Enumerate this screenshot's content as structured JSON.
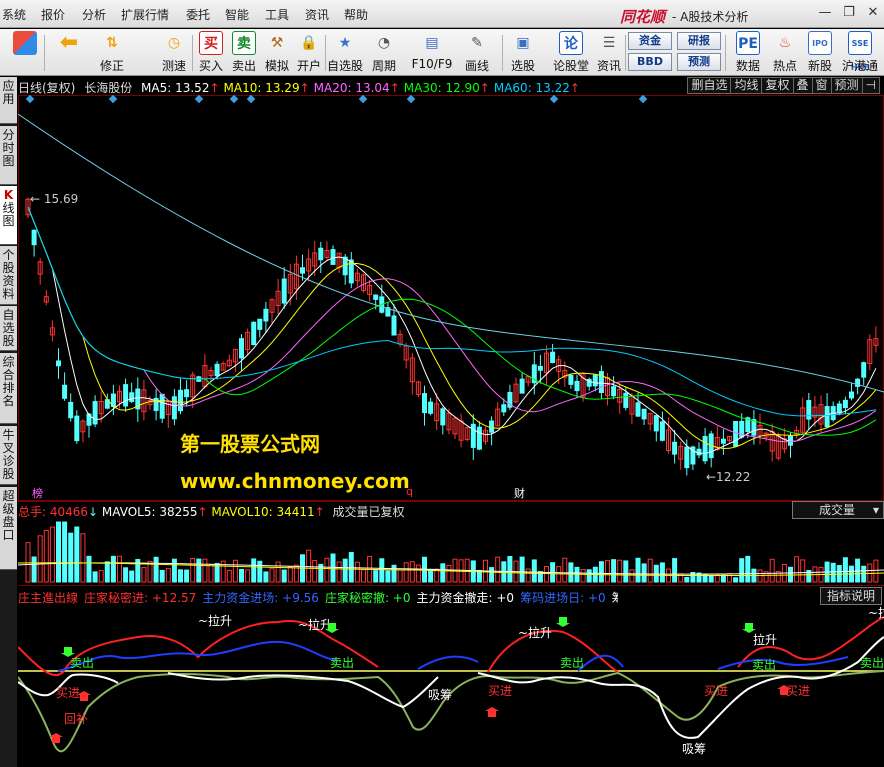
{
  "menu": [
    "系统",
    "报价",
    "分析",
    "扩展行情",
    "委托",
    "智能",
    "工具",
    "资讯",
    "帮助"
  ],
  "brand": "同花顺",
  "app_title": "- A股技术分析",
  "toolbar": {
    "items": [
      {
        "label": "",
        "icon": "grid-icon",
        "color": "#e84c3d"
      },
      {
        "label": "",
        "icon": "back-arrow-icon",
        "color": "#f0a20a"
      },
      {
        "label": "修正",
        "icon": "up-down-arrows-icon",
        "color": "#f0a20a"
      },
      {
        "label": "测速",
        "icon": "clock-icon",
        "color": "#f0a20a"
      },
      {
        "label": "买入",
        "icon": "buy-icon",
        "glyph": "买",
        "color": "#d21f1f"
      },
      {
        "label": "卖出",
        "icon": "sell-icon",
        "glyph": "卖",
        "color": "#158a2e"
      },
      {
        "label": "模拟",
        "icon": "gavel-icon",
        "color": "#b5651d"
      },
      {
        "label": "开户",
        "icon": "lock-icon",
        "color": "#c8a000"
      },
      {
        "label": "自选股",
        "icon": "star-folder-icon",
        "color": "#3a6fc4"
      },
      {
        "label": "周期",
        "icon": "clock-cycle-icon",
        "color": "#555"
      },
      {
        "label": "F10/F9",
        "icon": "f10-icon",
        "color": "#3a6fc4"
      },
      {
        "label": "画线",
        "icon": "pencil-icon",
        "color": "#555"
      },
      {
        "label": "选股",
        "icon": "chart-select-icon",
        "color": "#3a6fc4"
      },
      {
        "label": "论股堂",
        "icon": "lun-icon",
        "glyph": "论",
        "color": "#1f5fbf"
      },
      {
        "label": "资讯",
        "icon": "news-icon",
        "color": "#555"
      },
      {
        "label": "数据",
        "icon": "pe-icon",
        "glyph": "PE",
        "color": "#1f5fbf"
      },
      {
        "label": "热点",
        "icon": "hot-icon",
        "color": "#d2402d"
      },
      {
        "label": "新股",
        "icon": "ipo-icon",
        "glyph": "IPO",
        "color": "#3a6fc4"
      },
      {
        "label": "沪港通",
        "icon": "hk-connect-icon",
        "glyph": "SSE HKE",
        "color": "#1f5fbf"
      }
    ],
    "small_buttons": [
      "资金",
      "研报",
      "BBD",
      "预测"
    ]
  },
  "sidebar": [
    {
      "label": "应用"
    },
    {
      "label": "分时图"
    },
    {
      "label": "K线图",
      "active": true
    },
    {
      "label": "个股资料"
    },
    {
      "label": "自选股"
    },
    {
      "label": "综合排名"
    },
    {
      "label": "牛叉诊股"
    },
    {
      "label": "超级盘口"
    }
  ],
  "header": {
    "chart_title": "日线(复权)",
    "stock": "长海股份",
    "ma": [
      {
        "label": "MA5: 13.52",
        "color": "#ffffff"
      },
      {
        "label": "MA10: 13.29",
        "color": "#ffff00"
      },
      {
        "label": "MA20: 13.04",
        "color": "#ff66ff"
      },
      {
        "label": "MA30: 12.90",
        "color": "#00ff00"
      },
      {
        "label": "MA60: 13.22",
        "color": "#00ccff"
      }
    ],
    "ma_arrow": "↑",
    "right_buttons": [
      "删自选",
      "均线",
      "复权",
      "叠",
      "窗",
      "预测",
      "⊣"
    ]
  },
  "price_labels": {
    "high": "15.69",
    "low": "12.22"
  },
  "event_markers": [
    "榜",
    "q",
    "财"
  ],
  "watermark": {
    "line1": "第一股票公式网",
    "line2": "www.chnmoney.com"
  },
  "volume": {
    "total_label": "总手: 40466",
    "mavol5": "MAVOL5: 38255",
    "mavol10": "MAVOL10: 34411",
    "note": "成交量已复权",
    "selector": "成交量"
  },
  "indicator": {
    "legend": [
      {
        "text": "庄主進出線",
        "color": "#ff3030"
      },
      {
        "text": "庄家秘密进: +12.57",
        "color": "#ff3030"
      },
      {
        "text": "主力资金进场: +9.56",
        "color": "#3366ff"
      },
      {
        "text": "庄家秘密撤: +0",
        "color": "#33ff33"
      },
      {
        "text": "主力资金撤走: +0",
        "color": "#ffffff"
      },
      {
        "text": "筹码进场日: +0",
        "color": "#3366ff"
      },
      {
        "text": "筹码",
        "color": "#ffffff"
      }
    ],
    "explain_button": "指标说明",
    "signals": {
      "pull": "拉升",
      "sell": "卖出",
      "buy": "买进",
      "absorb": "吸筹",
      "return": "回补"
    }
  },
  "colors": {
    "up": "#ff3232",
    "down": "#54ffff",
    "bg": "#000000",
    "grid": "#7a0000"
  }
}
